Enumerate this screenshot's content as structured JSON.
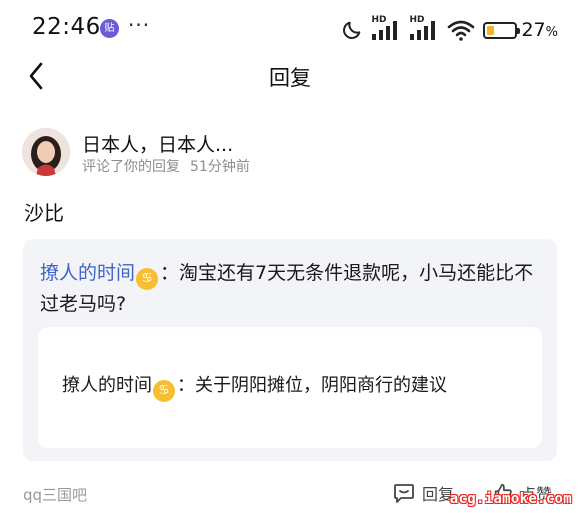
{
  "status_bar": {
    "time": "22:46",
    "app_icon_char": "贴",
    "more": "···",
    "network_label": "HD",
    "battery_percent": "27",
    "battery_unit": "%",
    "battery_level": 0.27,
    "battery_color": "#f0b428"
  },
  "nav": {
    "title": "回复"
  },
  "notification": {
    "user_name": "日本人，日本人...",
    "action_text": "评论了你的回复",
    "time_ago": "51分钟前",
    "comment": "沙比"
  },
  "quote": {
    "author": "撩人的时间",
    "zodiac_icon": "cancer-zodiac-icon",
    "text": "：淘宝还有7天无条件退款呢，小马还能比不过老马吗?",
    "inner": {
      "author": "撩人的时间",
      "text": "：关于阴阳摊位，阴阳商行的建议"
    }
  },
  "footer": {
    "forum": "qq三国吧",
    "reply_label": "回复",
    "like_label": "点赞",
    "watermark": "acg.iamoke.com"
  },
  "colors": {
    "accent_author": "#3d64c8",
    "quote_bg": "#f3f4f8",
    "zodiac": "#f7bf2f"
  }
}
